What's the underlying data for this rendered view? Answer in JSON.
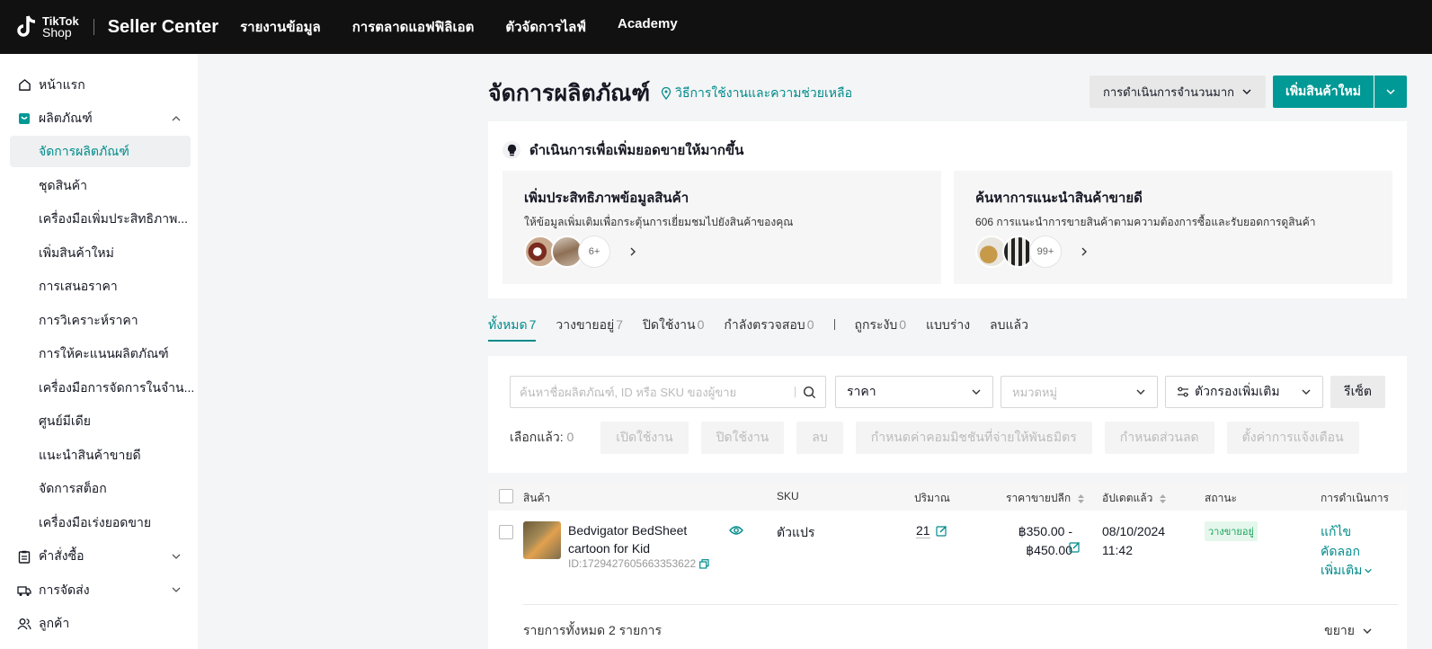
{
  "topbar": {
    "logo_line1": "TikTok",
    "logo_line2": "Shop",
    "brand": "Seller Center",
    "nav": [
      "รายงานข้อมูล",
      "การตลาดแอฟฟิลิเอต",
      "ตัวจัดการไลฟ์",
      "Academy"
    ]
  },
  "sidebar": {
    "home": "หน้าแรก",
    "products": "ผลิตภัณฑ์",
    "product_items": [
      "จัดการผลิตภัณฑ์",
      "ชุดสินค้า",
      "เครื่องมือเพิ่มประสิทธิภาพ...",
      "เพิ่มสินค้าใหม่",
      "การเสนอราคา",
      "การวิเคราะห์ราคา",
      "การให้คะแนนผลิตภัณฑ์",
      "เครื่องมือการจัดการในจำน...",
      "ศูนย์มีเดีย",
      "แนะนำสินค้าขายดี",
      "จัดการสต็อก",
      "เครื่องมือเร่งยอดขาย"
    ],
    "orders": "คำสั่งซื้อ",
    "shipping": "การจัดส่ง",
    "customers": "ลูกค้า"
  },
  "header": {
    "title": "จัดการผลิตภัณฑ์",
    "help": "วิธีการใช้งานและความช่วยเหลือ",
    "bulk_label": "การดำเนินการจำนวนมาก",
    "add_label": "เพิ่มสินค้าใหม่"
  },
  "promo": {
    "heading": "ดำเนินการเพื่อเพิ่มยอดขายให้มากขึ้น",
    "card1": {
      "title": "เพิ่มประสิทธิภาพข้อมูลสินค้า",
      "desc": "ให้ข้อมูลเพิ่มเติมเพื่อกระตุ้นการเยี่ยมชมไปยังสินค้าของคุณ",
      "count": "6+"
    },
    "card2": {
      "title": "ค้นหาการแนะนำสินค้าขายดี",
      "desc": "606 การแนะนำการขายสินค้าตามความต้องการซื้อและรับยอดการดูสินค้า",
      "count": "99+"
    }
  },
  "tabs": [
    {
      "label": "ทั้งหมด",
      "count": "7"
    },
    {
      "label": "วางขายอยู่",
      "count": "7"
    },
    {
      "label": "ปิดใช้งาน",
      "count": "0"
    },
    {
      "label": "กำลังตรวจสอบ",
      "count": "0"
    },
    {
      "label": "ถูกระงับ",
      "count": "0"
    },
    {
      "label": "แบบร่าง",
      "count": ""
    },
    {
      "label": "ลบแล้ว",
      "count": ""
    }
  ],
  "filters": {
    "search_placeholder": "ค้นหาชื่อผลิตภัณฑ์, ID หรือ SKU ของผู้ขาย",
    "price": "ราคา",
    "category_placeholder": "หมวดหมู่",
    "more_filters": "ตัวกรองเพิ่มเติม",
    "reset": "รีเซ็ต",
    "selected_label": "เลือกแล้ว:",
    "selected_count": "0",
    "bulk_buttons": [
      "เปิดใช้งาน",
      "ปิดใช้งาน",
      "ลบ",
      "กำหนดค่าคอมมิชชันที่จ่ายให้พันธมิตร",
      "กำหนดส่วนลด",
      "ตั้งค่าการแจ้งเตือน"
    ]
  },
  "table": {
    "headers": {
      "product": "สินค้า",
      "sku": "SKU",
      "qty": "ปริมาณ",
      "price": "ราคาขายปลีก",
      "updated": "อัปเดตแล้ว",
      "status": "สถานะ",
      "actions": "การดำเนินการ"
    },
    "row": {
      "name": "Bedvigator BedSheet cartoon for Kid",
      "id": "ID:1729427605663353622",
      "sku": "ตัวแปร",
      "qty": "21",
      "price_min": "฿350.00 -",
      "price_max": "฿450.00",
      "date": "08/10/2024",
      "time": "11:42",
      "status": "วางขายอยู่",
      "action_edit": "แก้ไข",
      "action_copy": "คัดลอก",
      "action_more": "เพิ่มเติม"
    },
    "footer_total": "รายการทั้งหมด 2 รายการ",
    "footer_expand": "ขยาย"
  },
  "colors": {
    "accent": "#009995",
    "topbar": "#111111"
  }
}
